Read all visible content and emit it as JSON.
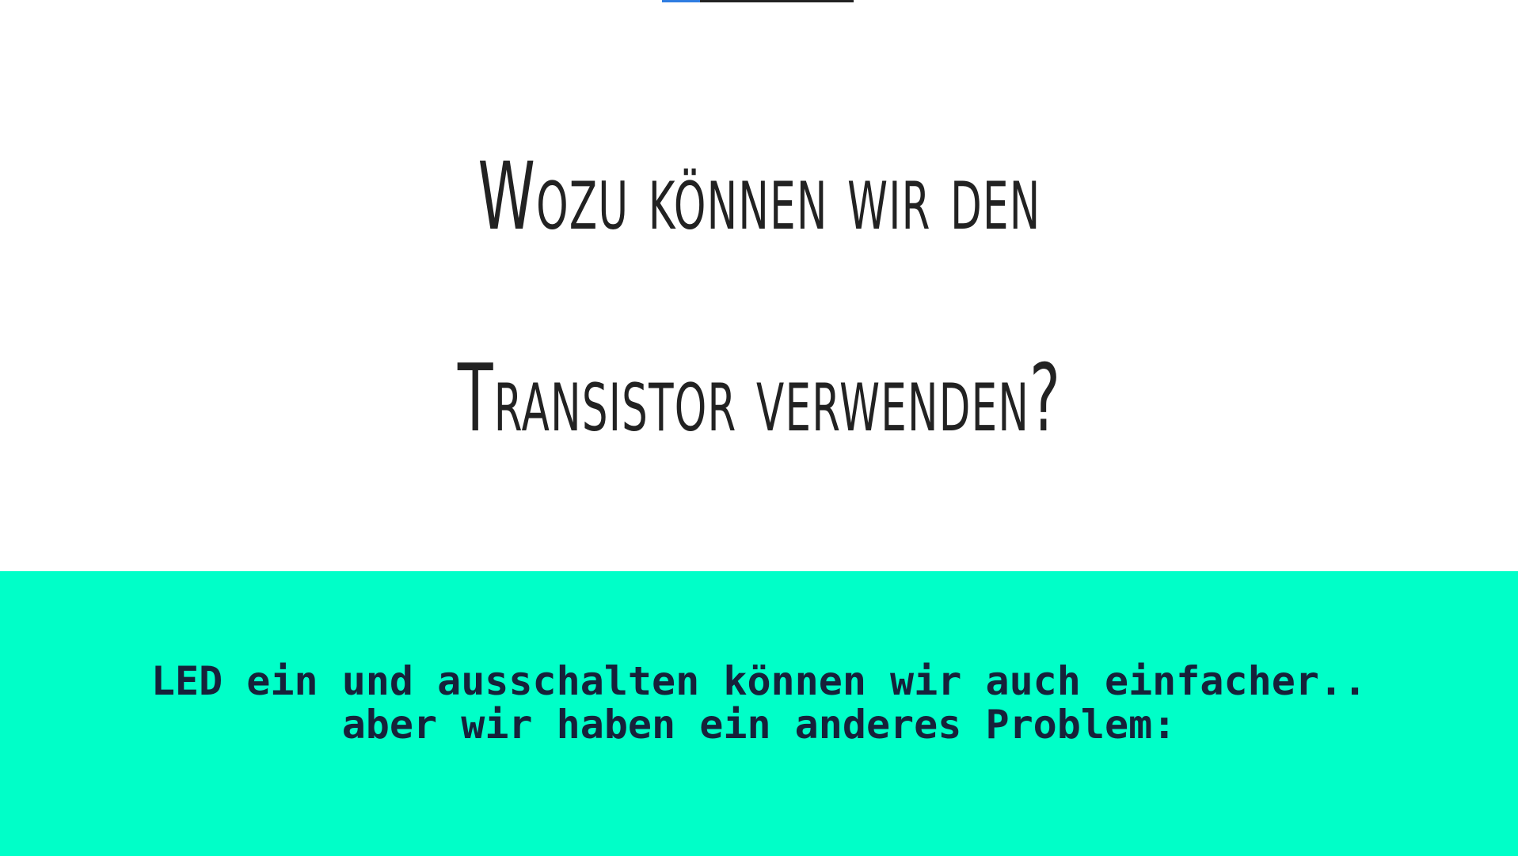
{
  "slide": {
    "progress": {
      "fraction": 0.2,
      "fill_color": "#2f7de1",
      "track_color": "#222222"
    },
    "title": {
      "line1": "Wozu können wir den",
      "line2": "Transistor verwenden?",
      "color": "#222222"
    },
    "band": {
      "color": "#00ffc8",
      "text_color": "#16213a",
      "line1": "LED ein und ausschalten können wir auch einfacher..",
      "line2": "aber wir haben ein anderes Problem:"
    }
  }
}
